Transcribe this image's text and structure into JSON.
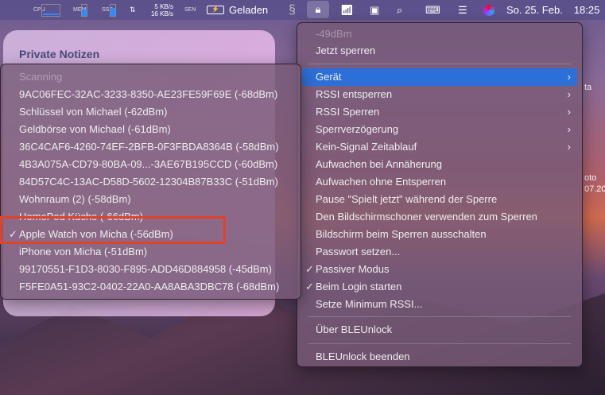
{
  "menubar": {
    "cpu_label": "CPU",
    "mem_label": "MEM",
    "ssd_label": "SSD",
    "net_up": "5 KB/s",
    "net_down": "16 KB/s",
    "sen_label": "SEN",
    "battery_status": "Geladen",
    "date": "So. 25. Feb.",
    "time": "18:25"
  },
  "widget": {
    "title": "Private Notizen"
  },
  "background_text": [
    "ta",
    "oto",
    "07.20"
  ],
  "device_menu": {
    "items": [
      {
        "label": "Scanning",
        "disabled": true
      },
      {
        "label": "9AC06FEC-32AC-3233-8350-AE23FE59F69E (-68dBm)"
      },
      {
        "label": "Schlüssel von Michael (-62dBm)"
      },
      {
        "label": "Geldbörse von Michael (-61dBm)"
      },
      {
        "label": "36C4CAF6-4260-74EF-2BFB-0F3FBDA8364B (-58dBm)"
      },
      {
        "label": "4B3A075A-CD79-80BA-09...-3AE67B195CCD (-60dBm)"
      },
      {
        "label": "84D57C4C-13AC-D58D-5602-12304B87B33C (-51dBm)"
      },
      {
        "label": "Wohnraum (2) (-58dBm)"
      },
      {
        "label": "HomePod Küche (-66dBm)"
      },
      {
        "label": "Apple Watch von Micha (-56dBm)",
        "checked": true
      },
      {
        "label": "iPhone von Micha (-51dBm)"
      },
      {
        "label": "99170551-F1D3-8030-F895-ADD46D884958 (-45dBm)"
      },
      {
        "label": "F5FE0A51-93C2-0402-22A0-AA8ABA3DBC78 (-68dBm)"
      }
    ]
  },
  "main_menu": {
    "rssi": "-49dBm",
    "lock_now": "Jetzt sperren",
    "items": [
      {
        "label": "Gerät",
        "submenu": true,
        "highlighted": true
      },
      {
        "label": "RSSI entsperren",
        "submenu": true
      },
      {
        "label": "RSSI Sperren",
        "submenu": true
      },
      {
        "label": "Sperrverzögerung",
        "submenu": true
      },
      {
        "label": "Kein-Signal Zeitablauf",
        "submenu": true
      },
      {
        "label": "Aufwachen bei Annäherung"
      },
      {
        "label": "Aufwachen ohne Entsperren"
      },
      {
        "label": "Pause \"Spielt jetzt\" während der Sperre"
      },
      {
        "label": "Den Bildschirmschoner verwenden zum Sperren"
      },
      {
        "label": "Bildschirm beim Sperren ausschalten"
      },
      {
        "label": "Passwort setzen..."
      },
      {
        "label": "Passiver Modus",
        "checked": true
      },
      {
        "label": "Beim Login starten",
        "checked": true
      },
      {
        "label": "Setze Minimum RSSI..."
      }
    ],
    "about": "Über BLEUnlock",
    "quit": "BLEUnlock beenden"
  },
  "checkmark": "✓",
  "chevron": "›",
  "colors": {
    "highlight": "#2d6fd8",
    "annotation": "#e0422a"
  }
}
